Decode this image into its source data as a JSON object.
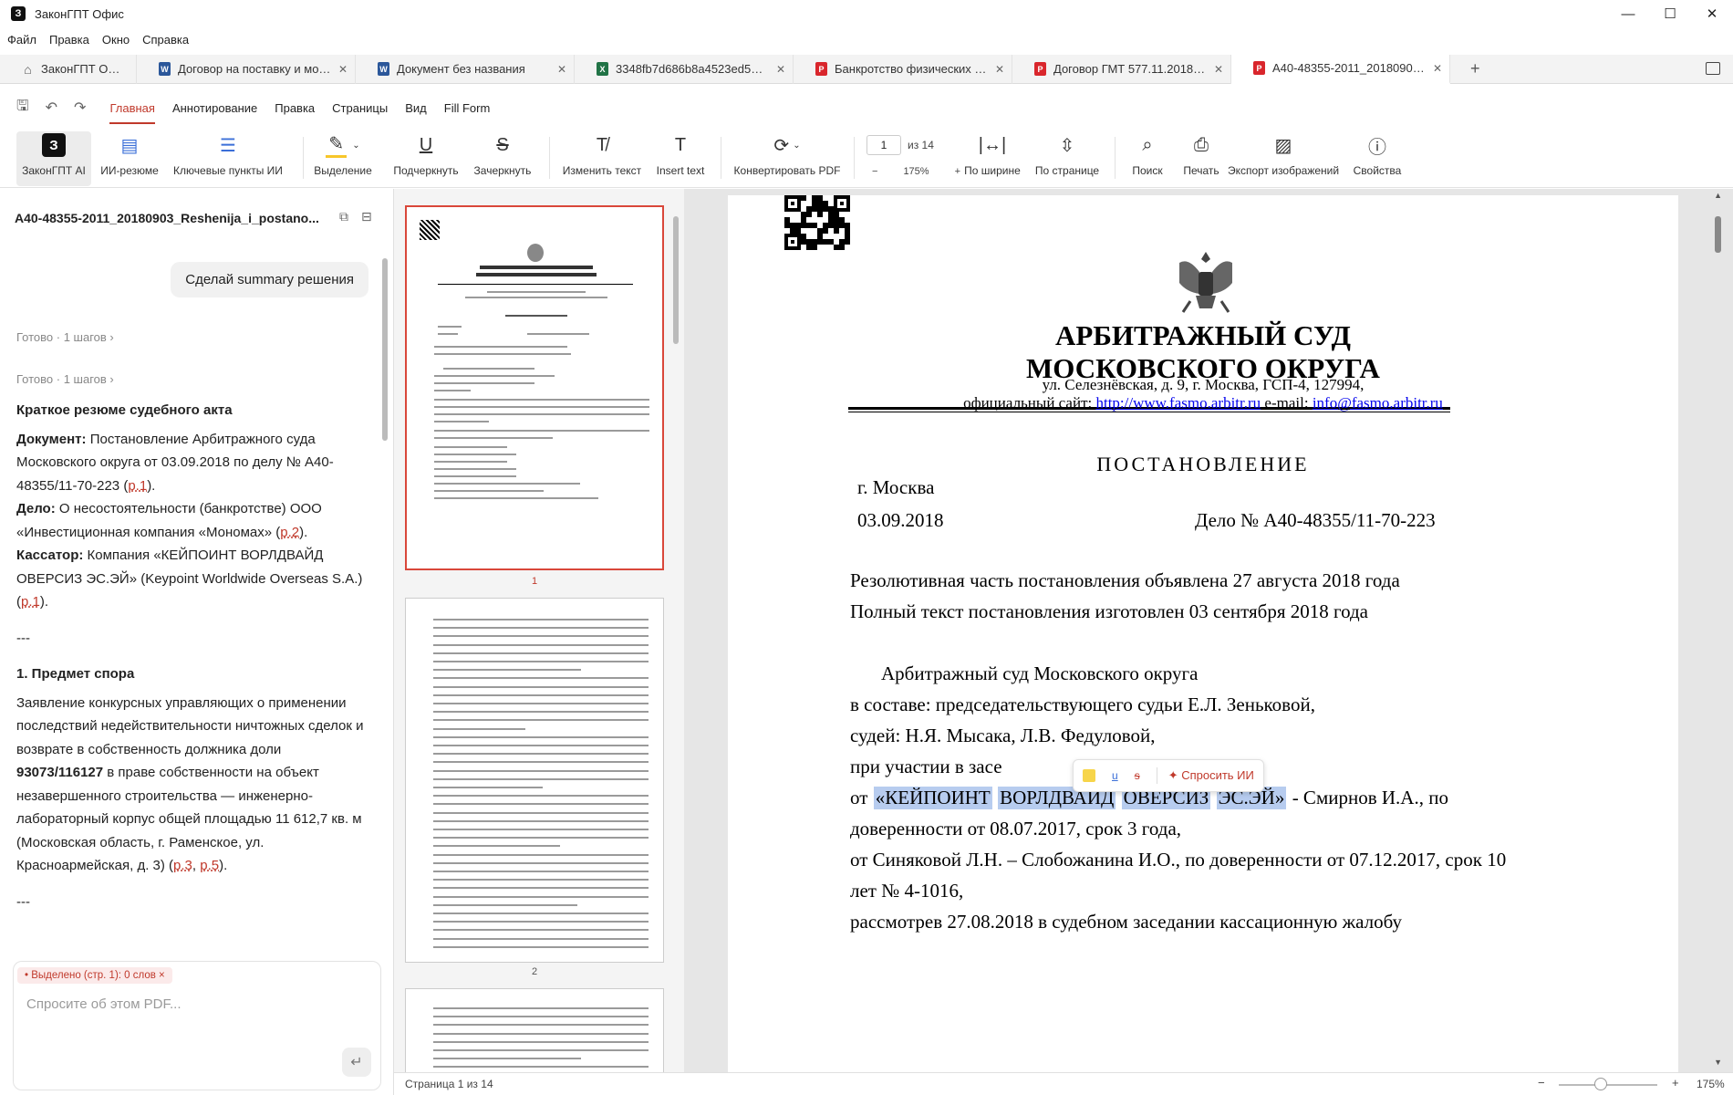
{
  "window": {
    "app_logo": "З",
    "title": "ЗаконГПТ Офис",
    "minimize": "—",
    "maximize": "☐",
    "close": "✕"
  },
  "menu": [
    "Файл",
    "Правка",
    "Окно",
    "Справка"
  ],
  "tabs": [
    {
      "label": "ЗаконГПТ Офис",
      "icon": "home-icon",
      "closable": false
    },
    {
      "label": "Договор на поставку и мон...",
      "icon": "word-icon",
      "closable": true
    },
    {
      "label": "Документ без названия",
      "icon": "word-icon",
      "closable": true
    },
    {
      "label": "3348fb7d686b8a4523ed56bc...",
      "icon": "excel-icon",
      "closable": true
    },
    {
      "label": "Банкротство физических ли...",
      "icon": "pdf-icon",
      "closable": true
    },
    {
      "label": "Договор ГМТ 577.11.2018 от...",
      "icon": "pdf-icon",
      "closable": true
    },
    {
      "label": "А40-48355-2011_20180903_...",
      "icon": "pdf-icon",
      "closable": true,
      "active": true
    }
  ],
  "ribbon_tabs": [
    "Главная",
    "Аннотирование",
    "Правка",
    "Страницы",
    "Вид",
    "Fill Form"
  ],
  "toolbar": {
    "ai": "ЗаконГПТ AI",
    "ai_summary": "ИИ-резюме",
    "key_points": "Ключевые пункты ИИ",
    "highlight": "Выделение",
    "underline": "Подчеркнуть",
    "strikethrough": "Зачеркнуть",
    "edit_text": "Изменить текст",
    "insert_text": "Insert text",
    "convert_pdf": "Конвертировать PDF",
    "page_current": "1",
    "page_of": "из 14",
    "zoom_minus": "−",
    "zoom_value": "175%",
    "zoom_plus": "+",
    "fit_width": "По ширине",
    "fit_page": "По странице",
    "search": "Поиск",
    "print": "Печать",
    "export_images": "Экспорт изображений",
    "properties": "Свойства"
  },
  "left_panel": {
    "doc_name": "A40-48355-2011_20180903_Reshenija_i_postano...",
    "user_message": "Сделай summary решения",
    "status_1": "Готово · 1 шагов ›",
    "status_2": "Готово · 1 шагов ›",
    "heading": "Краткое резюме судебного акта",
    "doc_label": "Документ:",
    "doc_text": "Постановление Арбитражного суда Московского округа от 03.09.2018 по делу № А40-48355/11-70-223 (",
    "ref_p1": "p.1",
    "case_label": "Дело:",
    "case_text": "О несостоятельности (банкротстве) ООО «Инвестиционная компания «Мономах» (",
    "ref_p2": "p.2",
    "cassator_label": "Кассатор:",
    "cassator_text": "Компания «КЕЙПОИНТ ВОРЛДВАЙД ОВЕРСИЗ ЭС.ЭЙ» (Keypoint Worldwide Overseas S.A.) (",
    "ref_p1b": "p.1",
    "divider": "---",
    "section1": "1. Предмет спора",
    "s1_text_a": "Заявление конкурсных управляющих о применении последствий недействительности ничтожных сделок и возврате в собственность должника доли ",
    "s1_bold": "93073/116127",
    "s1_text_b": " в праве собственности на объект незавершенного строительства — инженерно-лабораторный корпус общей площадью 11 612,7 кв. м (Московская область, г. Раменское, ул. Красноармейская, д. 3) (",
    "ref_p3": "p.3",
    "ref_p5": "p.5",
    "divider2": "---",
    "selection_chip": "• Выделено (стр. 1): 0 слов ×",
    "input_placeholder": "Спросите об этом PDF...",
    "send_icon": "↵"
  },
  "thumbnails": {
    "labels": [
      "1",
      "2"
    ]
  },
  "document": {
    "court_line1": "АРБИТРАЖНЫЙ СУД",
    "court_line2": "МОСКОВСКОГО ОКРУГА",
    "address": "ул. Селезнёвская, д. 9, г. Москва, ГСП-4, 127994,",
    "site_prefix": "официальный сайт:",
    "site_url": "http://www.fasmo.arbitr.ru",
    "email_prefix": "e-mail:",
    "email": "info@fasmo.arbitr.ru",
    "title": "ПОСТАНОВЛЕНИЕ",
    "city": "г. Москва",
    "date": "03.09.2018",
    "case_no": "Дело № А40-48355/11-70-223",
    "line_resol": "Резолютивная часть постановления объявлена 27 августа 2018 года",
    "line_full": "Полный текст постановления изготовлен 03 сентября 2018 года",
    "line_court": "Арбитражный суд Московского округа",
    "line_comp": "в составе: председательствующего судьи Е.Л. Зеньковой,",
    "line_judges": "судей: Н.Я. Мысака, Л.В. Федуловой,",
    "line_part": "при участии в засе",
    "line_from": "от",
    "hl_words": [
      "«КЕЙПОИНТ",
      "ВОРЛДВАЙД",
      "ОВЕРСИЗ",
      "ЭС.ЭЙ»"
    ],
    "line_rep": "- Смирнов И.А., по",
    "line_power": "доверенности от 08.07.2017, срок 3 года,",
    "line_sin": "от Синяковой Л.Н. – Слобожанина И.О., по доверенности от 07.12.2017, срок 10",
    "line_years": "лет № 4-1016,",
    "line_cut": "рассмотрев 27.08.2018 в судебном заседании кассационную жалобу"
  },
  "float_toolbar": {
    "underline": "u",
    "strike": "s",
    "ask_ai": "✦ Спросить ИИ"
  },
  "statusbar": {
    "page": "Страница 1 из 14",
    "minus": "−",
    "plus": "+",
    "zoom": "175%"
  }
}
